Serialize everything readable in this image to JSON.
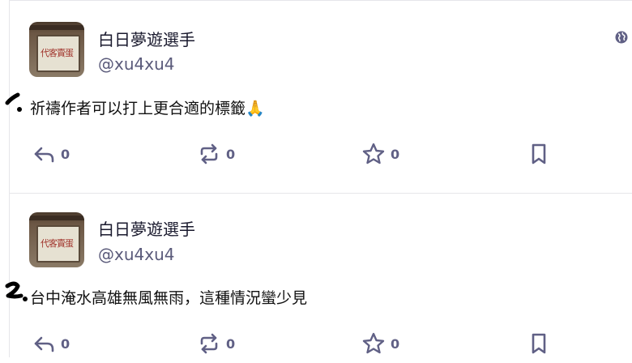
{
  "posts": [
    {
      "author_name": "白日夢遊選手",
      "author_handle": "@xu4xu4",
      "avatar_text": "代客賣蛋",
      "content": "祈禱作者可以打上更合適的標籤🙏",
      "annotation": "1.",
      "counts": {
        "replies": "0",
        "boosts": "0",
        "favourites": "0"
      }
    },
    {
      "author_name": "白日夢遊選手",
      "author_handle": "@xu4xu4",
      "avatar_text": "代客賣蛋",
      "content": "台中淹水高雄無風無雨，這種情況蠻少見",
      "annotation": "2.",
      "counts": {
        "replies": "0",
        "boosts": "0",
        "favourites": "0"
      }
    }
  ],
  "icons": {
    "visibility": "globe-icon",
    "reply": "reply-icon",
    "boost": "boost-icon",
    "favourite": "star-icon",
    "bookmark": "bookmark-icon"
  },
  "colors": {
    "icon": "#606085",
    "handle": "#5a5a7a",
    "divider": "#e6e6ea"
  }
}
